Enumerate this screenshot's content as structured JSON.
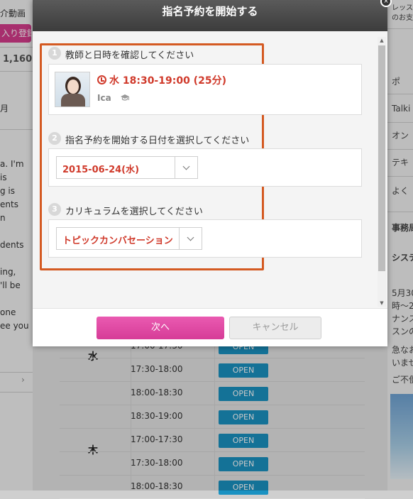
{
  "background": {
    "left": {
      "video_label": "介動画",
      "register_label": "入り登録",
      "count": "1,160",
      "month_label": "月",
      "text_lines": [
        "a. I'm",
        "is",
        "g is",
        "ents",
        "n",
        "dents",
        "ing,",
        "'ll be",
        "one",
        "ee you"
      ],
      "chevron": "›"
    },
    "right": {
      "top_label": "レッス",
      "top_label2": "のお支",
      "items": [
        "ポ",
        "Talki",
        "オン",
        "テキ",
        "よく",
        "事務局",
        "システ",
        "5月30",
        "時～2",
        "ナンス",
        "スンの",
        "急なお",
        "いませ",
        "ご不便"
      ]
    },
    "schedule": {
      "rows": [
        {
          "day": "水",
          "time": "17:00-17:30",
          "status": "OPEN"
        },
        {
          "day": "",
          "time": "17:30-18:00",
          "status": "OPEN"
        },
        {
          "day": "",
          "time": "18:00-18:30",
          "status": "OPEN"
        },
        {
          "day": "",
          "time": "18:30-19:00",
          "status": "OPEN"
        },
        {
          "day": "木",
          "time": "17:00-17:30",
          "status": "OPEN"
        },
        {
          "day": "",
          "time": "17:30-18:00",
          "status": "OPEN"
        },
        {
          "day": "",
          "time": "18:00-18:30",
          "status": "OPEN"
        }
      ]
    }
  },
  "modal": {
    "title": "指名予約を開始する",
    "steps": [
      {
        "num": "1",
        "title": "教師と日時を確認してください"
      },
      {
        "num": "2",
        "title": "指名予約を開始する日付を選択してください"
      },
      {
        "num": "3",
        "title": "カリキュラムを選択してください"
      }
    ],
    "lesson": {
      "time": "水 18:30-19:00 (25分)",
      "teacher": "Ica",
      "teacher_icon": "graduation-cap-icon"
    },
    "date_select": {
      "value": "2015-06-24(水)"
    },
    "curriculum_select": {
      "value": "トピックカンバセーション"
    },
    "next_label": "次へ",
    "cancel_label": "キャンセル"
  },
  "colors": {
    "accent_red": "#d03a2b",
    "highlight_border": "#d45a22",
    "next_button": "#d63c97",
    "open_button": "#1a92c2"
  }
}
